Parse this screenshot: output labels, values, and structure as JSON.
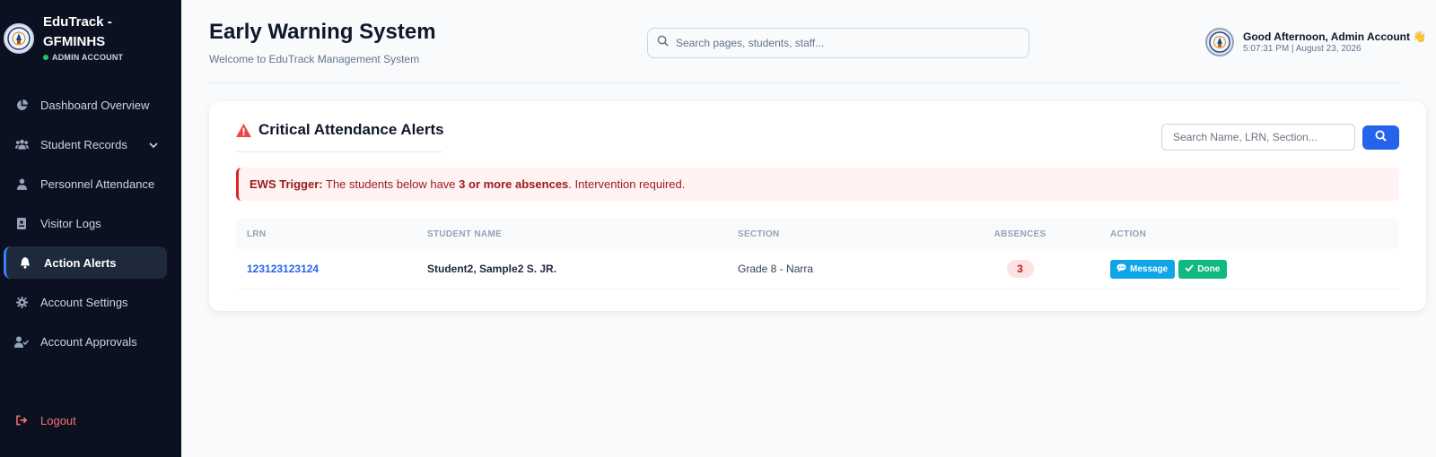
{
  "sidebar": {
    "brand_title_line1": "EduTrack -",
    "brand_title_line2": "GFMINHS",
    "brand_subtitle": "ADMIN ACCOUNT",
    "items": [
      {
        "label": "Dashboard Overview",
        "icon": "pie-chart-icon"
      },
      {
        "label": "Student Records",
        "icon": "users-icon"
      },
      {
        "label": "Personnel Attendance",
        "icon": "user-icon"
      },
      {
        "label": "Visitor Logs",
        "icon": "id-badge-icon"
      },
      {
        "label": "Action Alerts",
        "icon": "bell-icon"
      },
      {
        "label": "Account Settings",
        "icon": "gear-icon"
      },
      {
        "label": "Account Approvals",
        "icon": "user-check-icon"
      }
    ],
    "logout_label": "Logout"
  },
  "header": {
    "title": "Early Warning System",
    "subtitle": "Welcome to EduTrack Management System",
    "search_placeholder": "Search pages, students, staff...",
    "greeting": "Good Afternoon, Admin Account 👋",
    "time": "5:07:31 PM",
    "date": "August 23, 2026"
  },
  "card": {
    "title": "Critical Attendance Alerts",
    "search_placeholder": "Search Name, LRN, Section...",
    "alert": {
      "label": "EWS Trigger:",
      "text_before": " The students below have ",
      "emphasis": "3 or more absences",
      "text_after": ". Intervention required."
    },
    "columns": {
      "lrn": "LRN",
      "name": "STUDENT NAME",
      "section": "SECTION",
      "absences": "ABSENCES",
      "action": "ACTION"
    },
    "rows": [
      {
        "lrn": "123123123124",
        "name": "Student2, Sample2 S. JR.",
        "section": "Grade 8 - Narra",
        "absences": "3",
        "message_label": "Message",
        "done_label": "Done"
      }
    ]
  },
  "colors": {
    "sidebar_bg": "#0b1120",
    "accent": "#2563eb",
    "danger": "#dc2626",
    "success": "#10b981",
    "info": "#0ea5e9"
  }
}
